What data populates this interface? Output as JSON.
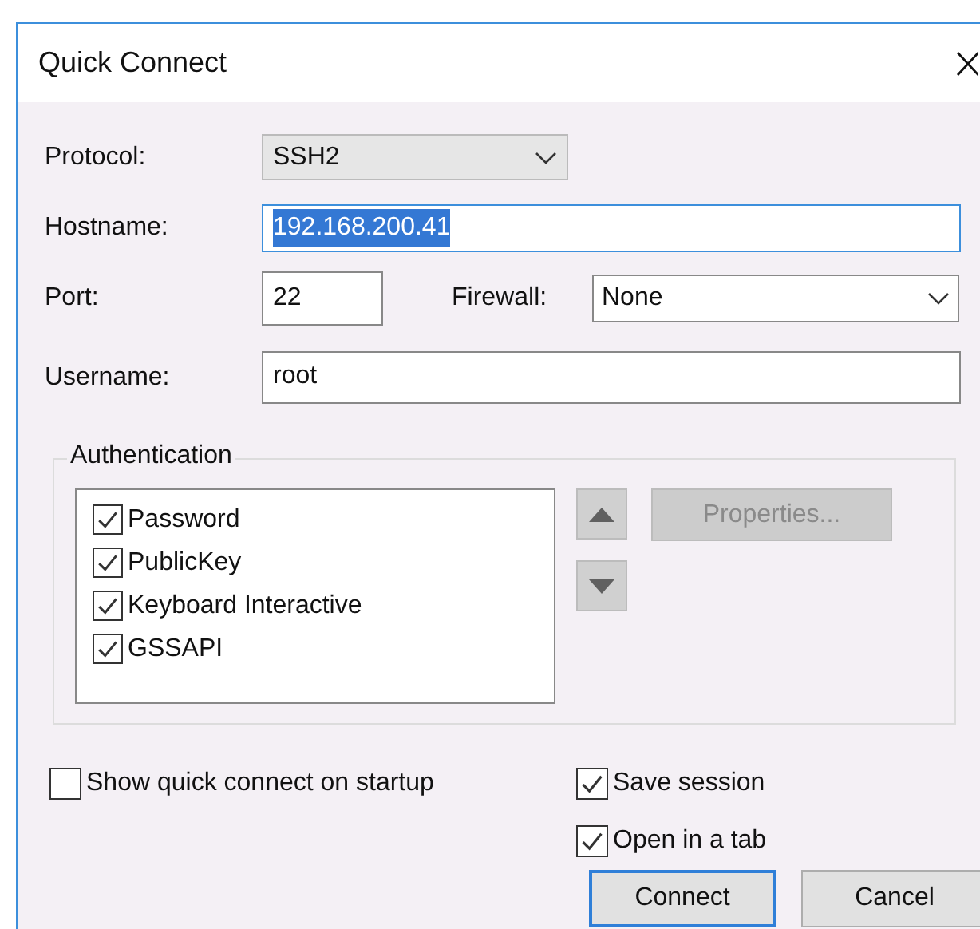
{
  "window": {
    "title": "Quick Connect"
  },
  "protocol": {
    "label": "Protocol:",
    "value": "SSH2"
  },
  "hostname": {
    "label": "Hostname:",
    "value": "192.168.200.41",
    "selected": true
  },
  "port": {
    "label": "Port:",
    "value": "22"
  },
  "firewall": {
    "label": "Firewall:",
    "value": "None"
  },
  "username": {
    "label": "Username:",
    "value": "root"
  },
  "authentication": {
    "title": "Authentication",
    "methods": [
      {
        "label": "Password",
        "checked": true
      },
      {
        "label": "PublicKey",
        "checked": true
      },
      {
        "label": "Keyboard Interactive",
        "checked": true
      },
      {
        "label": "GSSAPI",
        "checked": true
      }
    ],
    "properties": {
      "label": "Properties...",
      "disabled": true
    }
  },
  "options": [
    {
      "label": "Show quick connect on startup",
      "checked": false
    },
    {
      "label": "Save session",
      "checked": true
    },
    {
      "label": "Open in a tab",
      "checked": true
    }
  ],
  "buttons": [
    {
      "label": "Connect",
      "default": true
    },
    {
      "label": "Cancel",
      "default": false
    }
  ]
}
